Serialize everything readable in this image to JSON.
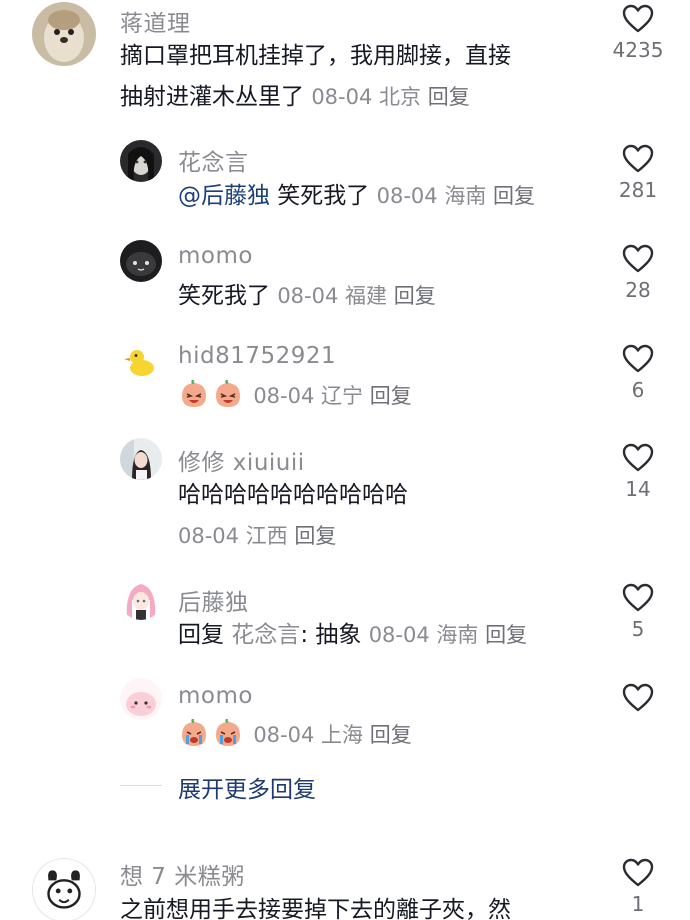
{
  "comments": [
    {
      "username": "蒋道理",
      "text_line1": "摘口罩把耳机挂掉了，我用脚接，直接",
      "text_line2": "抽射进灌木丛里了",
      "date": "08-04",
      "location": "北京",
      "reply_label": "回复",
      "likes": "4235",
      "avatar_icon": "otter-avatar"
    },
    {
      "username": "花念言",
      "mention": "@后藤独",
      "text": " 笑死我了",
      "date": "08-04",
      "location": "海南",
      "reply_label": "回复",
      "likes": "281",
      "avatar_icon": "girl-sketch-avatar"
    },
    {
      "username": "momo",
      "text": "笑死我了",
      "date": "08-04",
      "location": "福建",
      "reply_label": "回复",
      "likes": "28",
      "avatar_icon": "black-blob-avatar"
    },
    {
      "username": "hid81752921",
      "date": "08-04",
      "location": "辽宁",
      "reply_label": "回复",
      "likes": "6",
      "avatar_icon": "duck-avatar",
      "emojis": [
        "peach-laugh-emoji",
        "peach-laugh-emoji"
      ]
    },
    {
      "username": "修修 xiuiuii",
      "text": "哈哈哈哈哈哈哈哈哈哈",
      "date": "08-04",
      "location": "江西",
      "reply_label": "回复",
      "likes": "14",
      "avatar_icon": "girl-photo-avatar"
    },
    {
      "username": "后藤独",
      "reply_prefix": "回复",
      "quoted_user": " 花念言",
      "text": ": 抽象",
      "date": "08-04",
      "location": "海南",
      "reply_label": "回复",
      "likes": "5",
      "avatar_icon": "pink-hair-anime-avatar"
    },
    {
      "username": "momo",
      "date": "08-04",
      "location": "上海",
      "reply_label": "回复",
      "likes": "",
      "avatar_icon": "pink-creature-avatar",
      "emojis": [
        "peach-cry-emoji",
        "peach-cry-emoji"
      ]
    },
    {
      "username": "想 7 米糕粥",
      "text_line1": "之前想用手去接要掉下去的離子夾，然",
      "likes": "1",
      "avatar_icon": "cartoon-dog-avatar"
    }
  ],
  "expand_more": "展开更多回复",
  "colors": {
    "username": "#8a8b91",
    "text": "#161823",
    "mention": "#1b3f7a",
    "expand": "#1e3a6e"
  }
}
